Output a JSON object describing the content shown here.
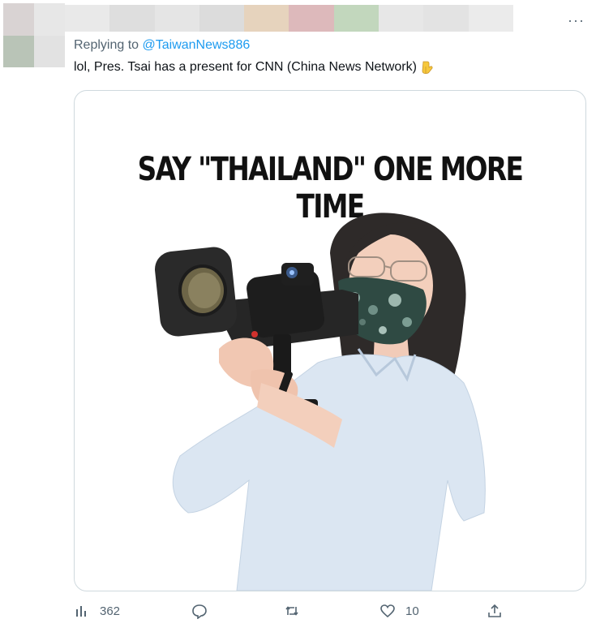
{
  "tweet": {
    "replying_to_label": "Replying to",
    "replying_to_handle": "@TaiwanNews886",
    "text": "lol, Pres. Tsai has a present for CNN (China News Network)",
    "emoji": "backhand-index-pointing-down",
    "more_label": "···"
  },
  "media": {
    "caption": "SAY \"THAILAND\" ONE MORE TIME"
  },
  "actions": {
    "views_count": "362",
    "likes_count": "10"
  },
  "colors": {
    "accent": "#1d9bf0",
    "muted": "#536471",
    "border": "#cfd9de"
  }
}
